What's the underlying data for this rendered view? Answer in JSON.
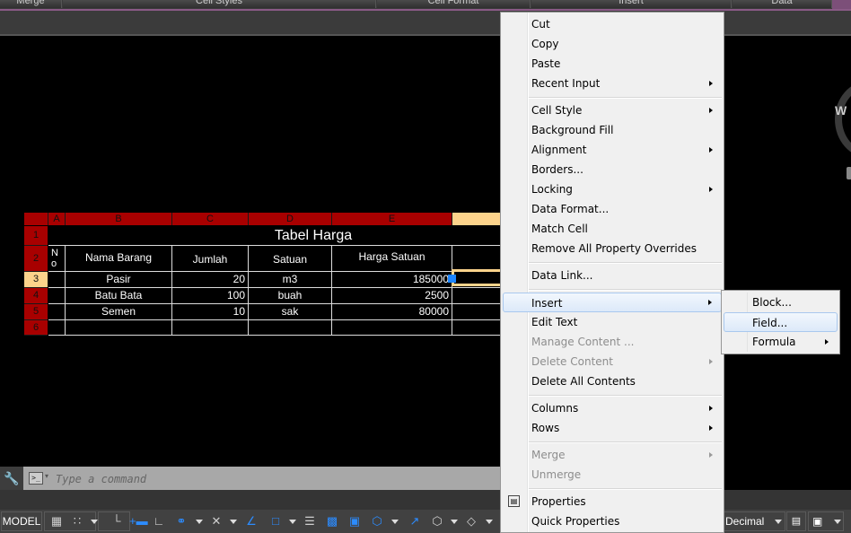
{
  "ribbon": {
    "panels": [
      "Merge",
      "Cell Styles",
      "Cell Format",
      "Insert",
      "Data"
    ]
  },
  "table": {
    "column_headers": [
      "A",
      "B",
      "C",
      "D",
      "E"
    ],
    "row_headers": [
      "1",
      "2",
      "3",
      "4",
      "5",
      "6"
    ],
    "title": "Tabel Harga",
    "headers": [
      "No",
      "Nama Barang",
      "Jumlah",
      "Satuan",
      "Harga Satuan"
    ],
    "rows": [
      [
        "",
        "Pasir",
        "20",
        "m3",
        "185000"
      ],
      [
        "",
        "Batu Bata",
        "100",
        "buah",
        "2500"
      ],
      [
        "",
        "Semen",
        "10",
        "sak",
        "80000"
      ],
      [
        "",
        "",
        "",
        "",
        ""
      ]
    ],
    "selected_row": "3"
  },
  "command_line": {
    "placeholder": "Type a command"
  },
  "status_bar": {
    "model_label": "MODEL",
    "units_label": "Decimal"
  },
  "navigation": {
    "viewcube_label": "W"
  },
  "context_menu": {
    "items": [
      {
        "label": "Cut",
        "submenu": false,
        "disabled": false
      },
      {
        "label": "Copy",
        "submenu": false,
        "disabled": false
      },
      {
        "label": "Paste",
        "submenu": false,
        "disabled": false
      },
      {
        "label": "Recent Input",
        "submenu": true,
        "disabled": false
      },
      {
        "label": "Cell Style",
        "submenu": true,
        "disabled": false
      },
      {
        "label": "Background Fill",
        "submenu": false,
        "disabled": false
      },
      {
        "label": "Alignment",
        "submenu": true,
        "disabled": false
      },
      {
        "label": "Borders...",
        "submenu": false,
        "disabled": false
      },
      {
        "label": "Locking",
        "submenu": true,
        "disabled": false
      },
      {
        "label": "Data Format...",
        "submenu": false,
        "disabled": false
      },
      {
        "label": "Match Cell",
        "submenu": false,
        "disabled": false
      },
      {
        "label": "Remove All Property Overrides",
        "submenu": false,
        "disabled": false
      },
      {
        "label": "Data Link...",
        "submenu": false,
        "disabled": false
      },
      {
        "label": "Insert",
        "submenu": true,
        "disabled": false,
        "highlighted": true
      },
      {
        "label": "Edit Text",
        "submenu": false,
        "disabled": false
      },
      {
        "label": "Manage Content ...",
        "submenu": false,
        "disabled": true
      },
      {
        "label": "Delete Content",
        "submenu": true,
        "disabled": true
      },
      {
        "label": "Delete All Contents",
        "submenu": false,
        "disabled": false
      },
      {
        "label": "Columns",
        "submenu": true,
        "disabled": false
      },
      {
        "label": "Rows",
        "submenu": true,
        "disabled": false
      },
      {
        "label": "Merge",
        "submenu": true,
        "disabled": true
      },
      {
        "label": "Unmerge",
        "submenu": false,
        "disabled": true
      },
      {
        "label": "Properties",
        "submenu": false,
        "disabled": false,
        "icon": "properties-icon"
      },
      {
        "label": "Quick Properties",
        "submenu": false,
        "disabled": false
      }
    ]
  },
  "insert_submenu": {
    "items": [
      {
        "label": "Block...",
        "submenu": false
      },
      {
        "label": "Field...",
        "submenu": false,
        "highlighted": true
      },
      {
        "label": "Formula",
        "submenu": true
      }
    ]
  }
}
